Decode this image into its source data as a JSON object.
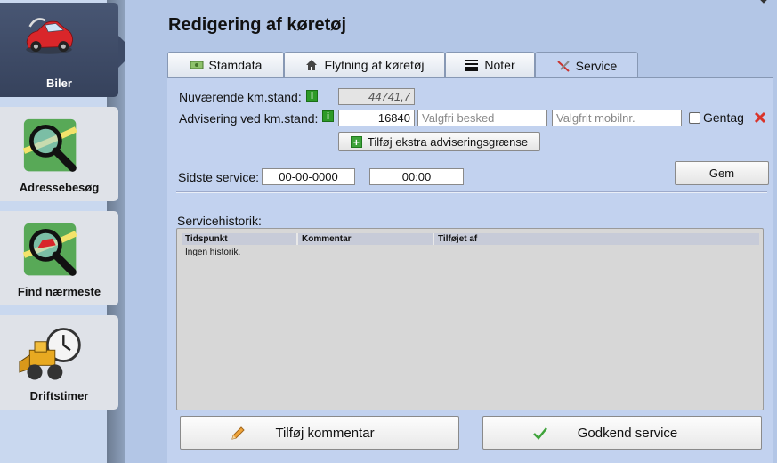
{
  "sidebar": {
    "items": [
      {
        "label": "Biler",
        "icon": "car-icon",
        "active": true
      },
      {
        "label": "Adressebesøg",
        "icon": "magnifier-map-icon",
        "active": false
      },
      {
        "label": "Find nærmeste",
        "icon": "magnifier-car-icon",
        "active": false
      },
      {
        "label": "Driftstimer",
        "icon": "loader-clock-icon",
        "active": false
      }
    ]
  },
  "page": {
    "title": "Redigering af køretøj"
  },
  "tabs": [
    {
      "label": "Stamdata",
      "icon": "money-icon"
    },
    {
      "label": "Flytning af køretøj",
      "icon": "house-icon"
    },
    {
      "label": "Noter",
      "icon": "lines-icon"
    },
    {
      "label": "Service",
      "icon": "tools-icon",
      "active": true
    }
  ],
  "service": {
    "km_label": "Nuværende km.stand:",
    "km_value": "44741,7",
    "alert_label": "Advisering ved km.stand:",
    "alert_value": "16840",
    "message_placeholder": "Valgfri besked",
    "mobile_placeholder": "Valgfrit mobilnr.",
    "repeat_label": "Gentag",
    "add_limit_label": "Tilføj ekstra adviseringsgrænse",
    "last_service_label": "Sidste service:",
    "last_service_date": "00-00-0000",
    "last_service_time": "00:00",
    "save_label": "Gem",
    "history_label": "Servicehistorik:",
    "history_columns": [
      "Tidspunkt",
      "Kommentar",
      "Tilføjet af"
    ],
    "history_empty": "Ingen historik.",
    "add_comment_label": "Tilføj kommentar",
    "approve_label": "Godkend service"
  },
  "colors": {
    "accent_green": "#3ea33a",
    "danger_red": "#d9342b",
    "active_nav": "#3d4a66"
  }
}
